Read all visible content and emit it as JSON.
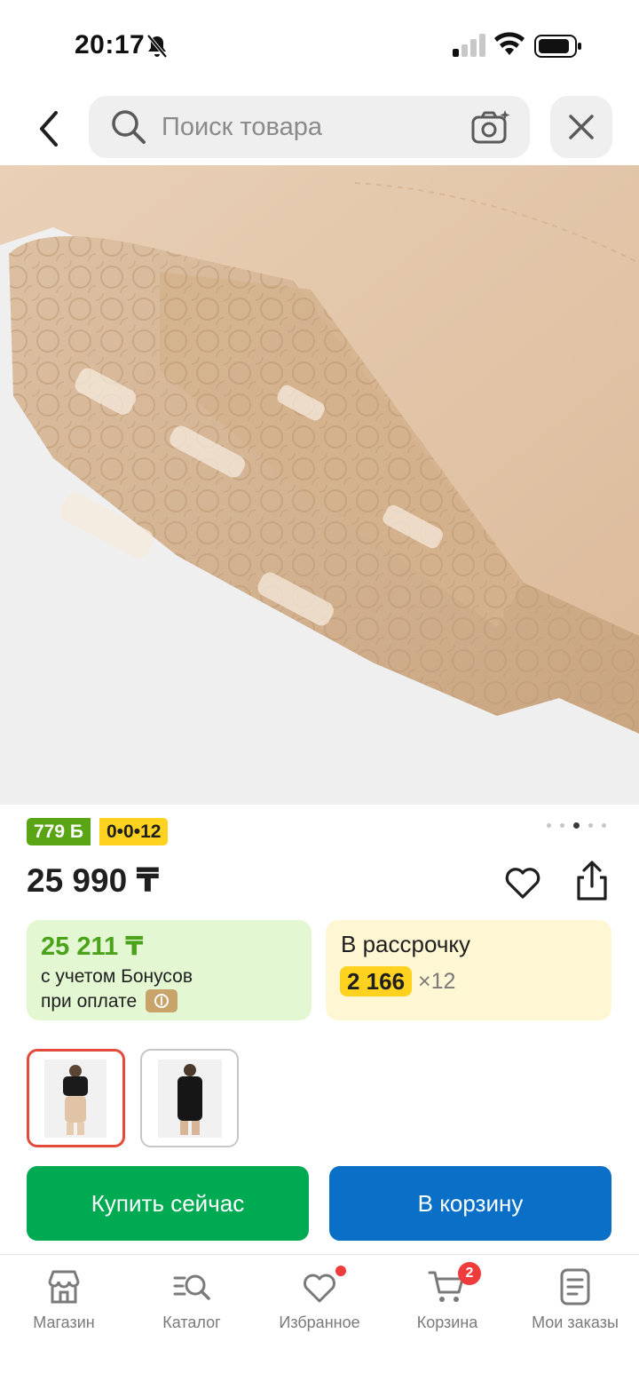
{
  "status_bar": {
    "time": "20:17"
  },
  "search": {
    "placeholder": "Поиск товара"
  },
  "product": {
    "bonus_badge": "779 Б",
    "installment_badge": "0•0•12",
    "price": "25 990 ₸",
    "image_pager": {
      "count": 5,
      "active_index": 3
    },
    "bonus_card": {
      "price": "25 211 ₸",
      "line1": "с учетом Бонусов",
      "line2": "при оплате"
    },
    "installment_card": {
      "title": "В рассрочку",
      "monthly_amount": "2 166",
      "months": "×12"
    },
    "variants": [
      {
        "selected": true
      },
      {
        "selected": false
      }
    ]
  },
  "actions": {
    "buy_now": "Купить сейчас",
    "add_to_cart": "В корзину"
  },
  "bottom_nav": {
    "items": [
      {
        "label": "Магазин",
        "icon": "store-icon"
      },
      {
        "label": "Каталог",
        "icon": "catalog-search-icon"
      },
      {
        "label": "Избранное",
        "icon": "heart-icon"
      },
      {
        "label": "Корзина",
        "icon": "cart-icon"
      },
      {
        "label": "Мои заказы",
        "icon": "orders-icon"
      }
    ],
    "cart_count": "2"
  },
  "colors": {
    "accent_green": "#00aa52",
    "accent_blue": "#0a6fc7",
    "bonus_green": "#59a515",
    "installment_yellow": "#ffd21f",
    "badge_red": "#ee3b3b"
  }
}
